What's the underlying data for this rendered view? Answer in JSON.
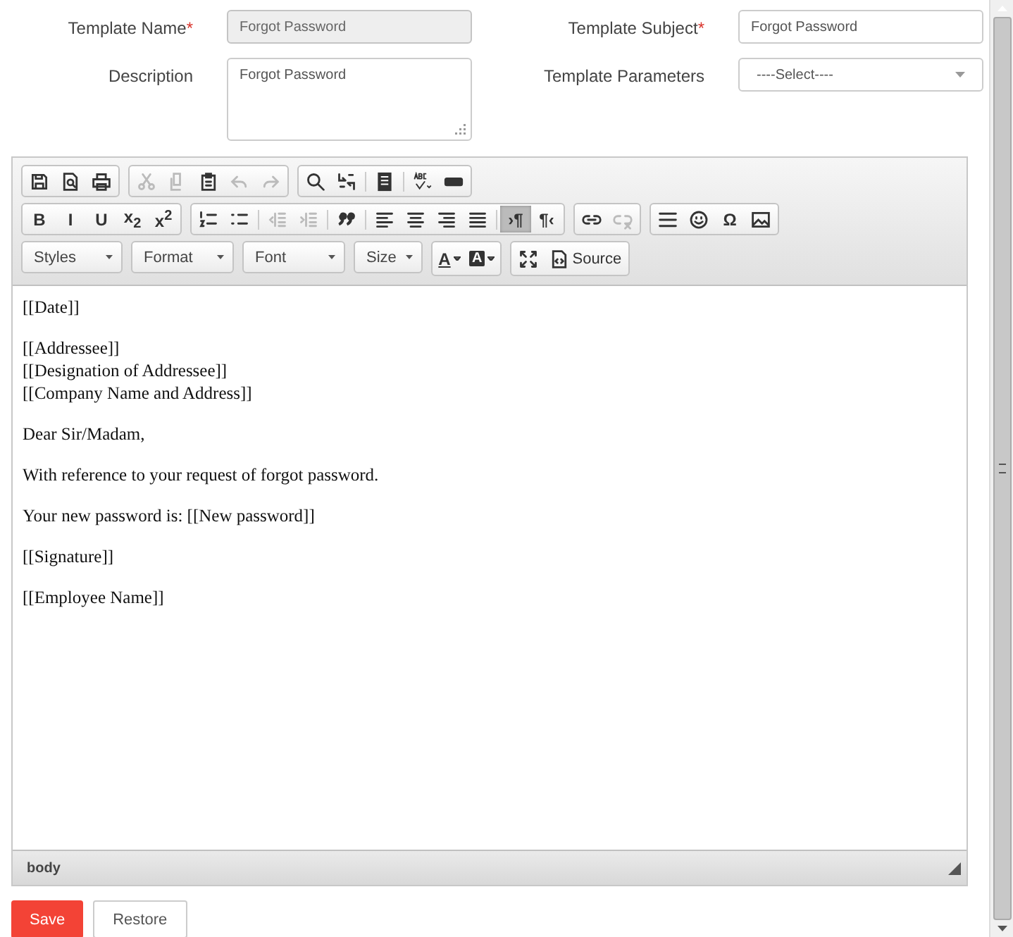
{
  "form": {
    "fields": [
      {
        "label": "Template Name",
        "required_mark": "*",
        "kind": "input",
        "value": "Forgot Password",
        "disabled": true
      },
      {
        "label": "Template Subject",
        "required_mark": "*",
        "kind": "input",
        "value": "Forgot Password",
        "disabled": false
      },
      {
        "label": "Description",
        "kind": "textarea",
        "value": "Forgot Password"
      },
      {
        "label": "Template Parameters",
        "kind": "select",
        "value": "----Select----"
      }
    ]
  },
  "toolbar": {
    "rows": [
      [
        [
          {
            "kind": "save",
            "disabled": false
          },
          {
            "kind": "preview",
            "disabled": false
          },
          {
            "kind": "print",
            "disabled": false
          }
        ],
        [
          {
            "kind": "cut",
            "disabled": true
          },
          {
            "kind": "copy",
            "disabled": true
          },
          {
            "kind": "paste",
            "disabled": false
          },
          {
            "kind": "undo",
            "disabled": true
          },
          {
            "kind": "redo",
            "disabled": true
          }
        ],
        [
          {
            "kind": "find",
            "disabled": false
          },
          {
            "kind": "replace",
            "disabled": false
          },
          {
            "kind": "separator"
          },
          {
            "kind": "selectall",
            "disabled": false
          },
          {
            "kind": "separator"
          },
          {
            "kind": "spellcheck",
            "disabled": false
          },
          {
            "kind": "textfield",
            "disabled": false
          }
        ]
      ],
      [
        [
          {
            "kind": "glyph",
            "glyph": "B",
            "disabled": false
          },
          {
            "kind": "glyph",
            "glyph": "I",
            "disabled": false
          },
          {
            "kind": "glyph",
            "glyph": "U",
            "disabled": false
          },
          {
            "kind": "glyph",
            "glyph": "x$_{2}$",
            "disabled": false
          },
          {
            "kind": "glyph",
            "glyph": "x$^{2}$",
            "disabled": false
          }
        ],
        [
          {
            "kind": "ol",
            "disabled": false
          },
          {
            "kind": "ul",
            "disabled": false
          },
          {
            "kind": "separator"
          },
          {
            "kind": "outdent",
            "disabled": true
          },
          {
            "kind": "indent",
            "disabled": true
          },
          {
            "kind": "separator"
          },
          {
            "kind": "blockquote",
            "disabled": false
          },
          {
            "kind": "separator"
          },
          {
            "kind": "align-left",
            "disabled": false
          },
          {
            "kind": "align-center",
            "disabled": false
          },
          {
            "kind": "align-right",
            "disabled": false
          },
          {
            "kind": "justify",
            "disabled": false
          },
          {
            "kind": "separator"
          },
          {
            "kind": "glyph",
            "glyph": "›¶",
            "disabled": false,
            "selected": true
          },
          {
            "kind": "glyph",
            "glyph": "¶‹",
            "disabled": false,
            "selected": false
          }
        ],
        [
          {
            "kind": "link",
            "disabled": false
          },
          {
            "kind": "unlink",
            "disabled": true
          }
        ],
        [
          {
            "kind": "hr",
            "disabled": false
          },
          {
            "kind": "smiley",
            "disabled": false
          },
          {
            "kind": "glyph",
            "glyph": "Ω",
            "disabled": false
          },
          {
            "kind": "image",
            "disabled": false
          }
        ]
      ],
      [
        [
          {
            "kind": "combo",
            "label": "Styles"
          }
        ],
        [
          {
            "kind": "combo",
            "label": "Format"
          }
        ],
        [
          {
            "kind": "combo",
            "label": "Font"
          }
        ],
        [
          {
            "kind": "combo",
            "label": "Size"
          }
        ],
        [
          {
            "kind": "textcolor",
            "glyph": "A",
            "disabled": false
          },
          {
            "kind": "bgcolor",
            "glyph": "A",
            "disabled": false
          }
        ],
        [
          {
            "kind": "maximize",
            "disabled": false
          },
          {
            "kind": "source",
            "label": "Source",
            "disabled": false
          }
        ]
      ]
    ]
  },
  "content": [
    [
      "[[Date]]"
    ],
    [
      "[[Addressee]]",
      "[[Designation of Addressee]]",
      "[[Company Name and Address]]"
    ],
    [
      "Dear Sir/Madam,"
    ],
    [
      "With reference to your request of forgot password."
    ],
    [
      "Your new password  is: [[New password]]"
    ],
    [
      "[[Signature]]"
    ],
    [
      "[[Employee Name]]"
    ]
  ],
  "status_bar": {
    "path": "body"
  },
  "buttons": [
    {
      "label": "Save",
      "kind": "primary"
    },
    {
      "label": "Restore",
      "kind": "default"
    }
  ]
}
